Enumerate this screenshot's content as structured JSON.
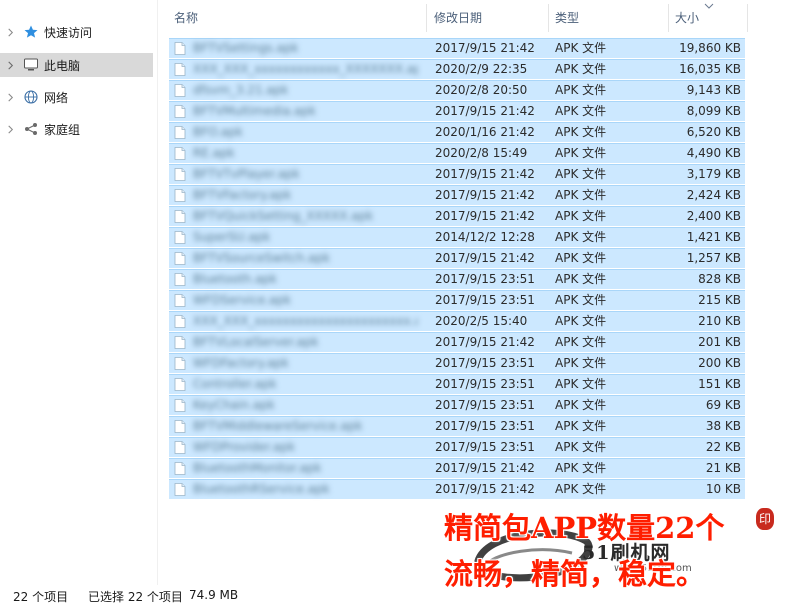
{
  "nav": {
    "items": [
      {
        "label": "快速访问",
        "icon": "star-icon"
      },
      {
        "label": "此电脑",
        "icon": "computer-icon"
      },
      {
        "label": "网络",
        "icon": "network-icon"
      },
      {
        "label": "家庭组",
        "icon": "homegroup-icon"
      }
    ]
  },
  "columns": {
    "name": "名称",
    "date": "修改日期",
    "type": "类型",
    "size": "大小"
  },
  "files": [
    {
      "name": "BFTVSettings.apk",
      "date": "2017/9/15 21:42",
      "type": "APK 文件",
      "size": "19,860 KB"
    },
    {
      "name": "XXX_XXX_xxxxxxxxxxxx_XXXXXXX.apk",
      "date": "2020/2/9 22:35",
      "type": "APK 文件",
      "size": "16,035 KB"
    },
    {
      "name": "dfsvm_3.21.apk",
      "date": "2020/2/8 20:50",
      "type": "APK 文件",
      "size": "9,143 KB"
    },
    {
      "name": "BFTVMultimedia.apk",
      "date": "2017/9/15 21:42",
      "type": "APK 文件",
      "size": "8,099 KB"
    },
    {
      "name": "BFO.apk",
      "date": "2020/1/16 21:42",
      "type": "APK 文件",
      "size": "6,520 KB"
    },
    {
      "name": "RE.apk",
      "date": "2020/2/8 15:49",
      "type": "APK 文件",
      "size": "4,490 KB"
    },
    {
      "name": "BFTVTvPlayer.apk",
      "date": "2017/9/15 21:42",
      "type": "APK 文件",
      "size": "3,179 KB"
    },
    {
      "name": "BFTVFactory.apk",
      "date": "2017/9/15 21:42",
      "type": "APK 文件",
      "size": "2,424 KB"
    },
    {
      "name": "BFTVQuickSetting_XXXXX.apk",
      "date": "2017/9/15 21:42",
      "type": "APK 文件",
      "size": "2,400 KB"
    },
    {
      "name": "SuperSU.apk",
      "date": "2014/12/2 12:28",
      "type": "APK 文件",
      "size": "1,421 KB"
    },
    {
      "name": "BFTVSourceSwitch.apk",
      "date": "2017/9/15 21:42",
      "type": "APK 文件",
      "size": "1,257 KB"
    },
    {
      "name": "Bluetooth.apk",
      "date": "2017/9/15 23:51",
      "type": "APK 文件",
      "size": "828 KB"
    },
    {
      "name": "WFDService.apk",
      "date": "2017/9/15 23:51",
      "type": "APK 文件",
      "size": "215 KB"
    },
    {
      "name": "XXX_XXX_xxxxxxxxxxxxxxxxxxxxxx.apk",
      "date": "2020/2/5 15:40",
      "type": "APK 文件",
      "size": "210 KB"
    },
    {
      "name": "BFTVLocalServer.apk",
      "date": "2017/9/15 21:42",
      "type": "APK 文件",
      "size": "201 KB"
    },
    {
      "name": "WFDFactory.apk",
      "date": "2017/9/15 23:51",
      "type": "APK 文件",
      "size": "200 KB"
    },
    {
      "name": "Controller.apk",
      "date": "2017/9/15 23:51",
      "type": "APK 文件",
      "size": "151 KB"
    },
    {
      "name": "KeyChain.apk",
      "date": "2017/9/15 23:51",
      "type": "APK 文件",
      "size": "69 KB"
    },
    {
      "name": "BFTVMiddlewareService.apk",
      "date": "2017/9/15 23:51",
      "type": "APK 文件",
      "size": "38 KB"
    },
    {
      "name": "WFDProvider.apk",
      "date": "2017/9/15 23:51",
      "type": "APK 文件",
      "size": "22 KB"
    },
    {
      "name": "BluetoothMonitor.apk",
      "date": "2017/9/15 21:42",
      "type": "APK 文件",
      "size": "21 KB"
    },
    {
      "name": "BluetoothRService.apk",
      "date": "2017/9/15 21:42",
      "type": "APK 文件",
      "size": "10 KB"
    }
  ],
  "status": {
    "item_count": "22 个项目",
    "selected": "已选择 22 个项目",
    "selected_size": "74.9 MB"
  },
  "overlay": {
    "line1": "精简包APP数量22个",
    "line2": "流畅，精简，稳定。",
    "watermark_text": "51刷机网",
    "watermark_url": "www.51tm.com",
    "seal_char": "印"
  },
  "colors": {
    "selection_fill": "#cce8ff",
    "selection_border": "#a9d6f9",
    "caption_red": "#ff1e00"
  }
}
